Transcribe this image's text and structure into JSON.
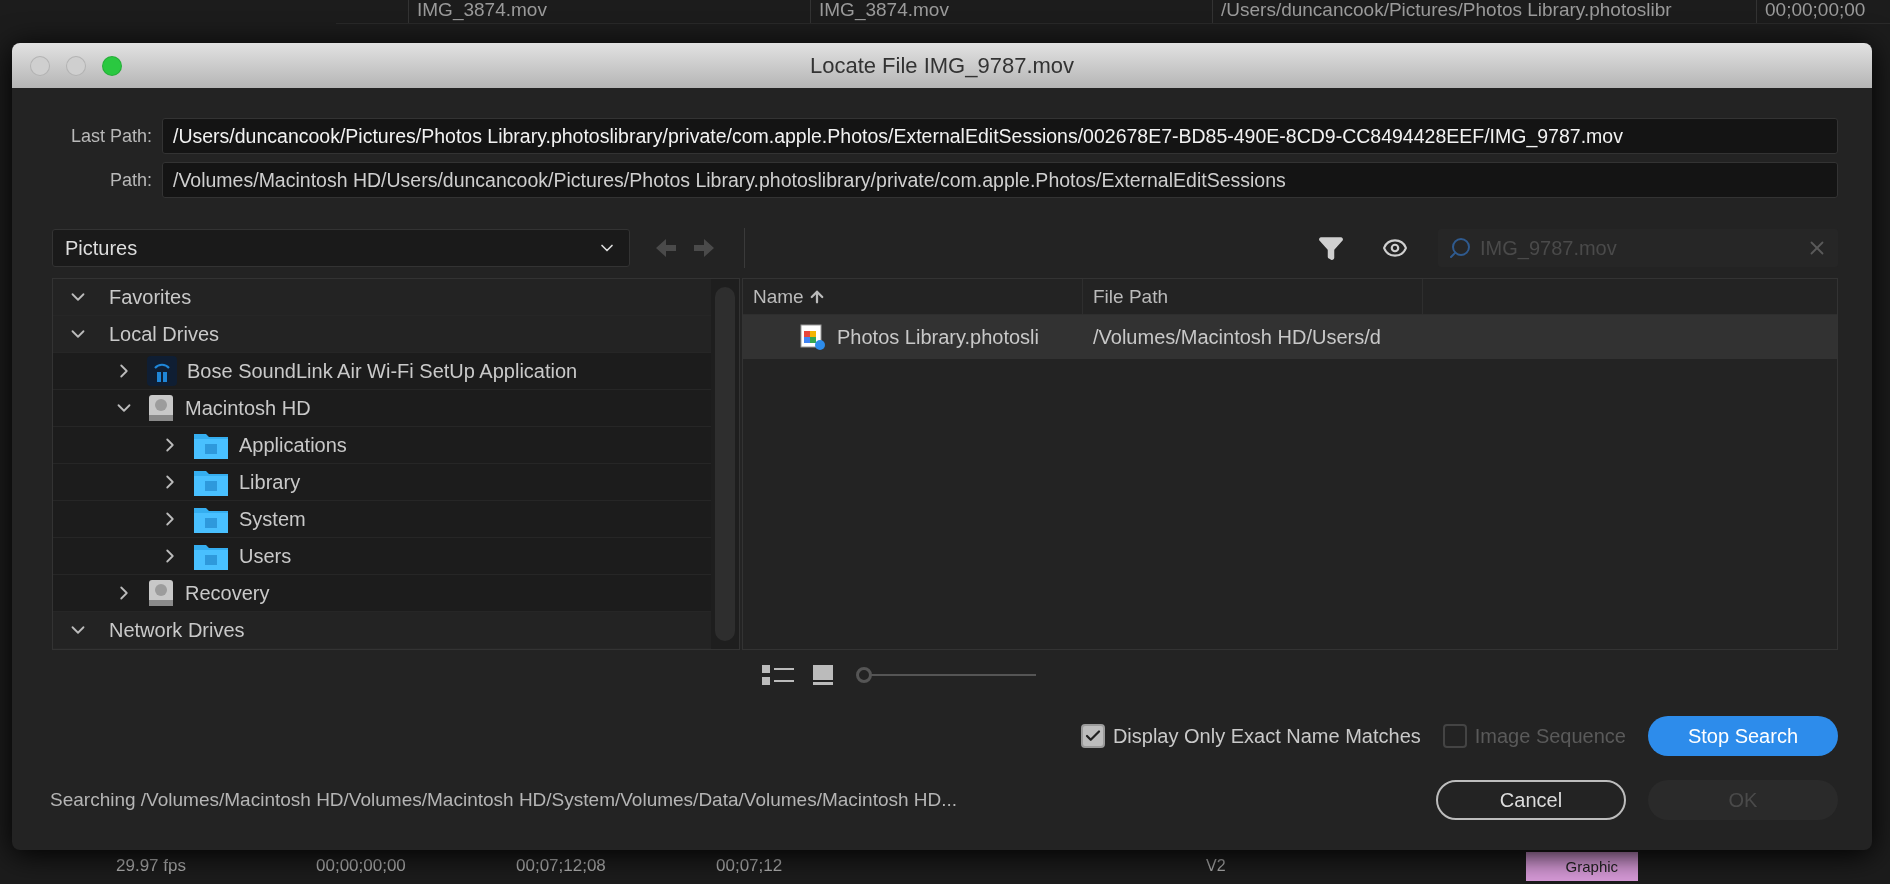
{
  "background": {
    "rows": [
      {
        "cells": [
          "IMG_3874.mov",
          "IMG_3874.mov",
          "/Users/duncancook/Pictures/Photos Library.photoslibr",
          "00;00;00;00"
        ]
      }
    ],
    "timeline": {
      "cells": [
        "29.97 fps",
        "00;00;00;00",
        "00;07;12;08",
        "00;07;12"
      ],
      "track": "V2",
      "clip": "Graphic"
    }
  },
  "dialog": {
    "title": "Locate File IMG_9787.mov",
    "last_path": {
      "label": "Last Path:",
      "value": "/Users/duncancook/Pictures/Photos Library.photoslibrary/private/com.apple.Photos/ExternalEditSessions/002678E7-BD85-490E-8CD9-CC8494428EEF/IMG_9787.mov"
    },
    "path": {
      "label": "Path:",
      "value": "/Volumes/Macintosh HD/Users/duncancook/Pictures/Photos Library.photoslibrary/private/com.apple.Photos/ExternalEditSessions"
    },
    "location": "Pictures",
    "search": {
      "value": "IMG_9787.mov",
      "disabled": true
    },
    "tree": [
      {
        "label": "Favorites",
        "kind": "section",
        "expanded": true
      },
      {
        "label": "Local Drives",
        "kind": "section",
        "expanded": true,
        "children": [
          {
            "label": "Bose SoundLink Air Wi-Fi SetUp Application",
            "kind": "app",
            "expanded": false
          },
          {
            "label": "Macintosh HD",
            "kind": "drive",
            "expanded": true,
            "children": [
              {
                "label": "Applications",
                "kind": "folder",
                "expanded": false
              },
              {
                "label": "Library",
                "kind": "folder",
                "expanded": false
              },
              {
                "label": "System",
                "kind": "folder",
                "expanded": false
              },
              {
                "label": "Users",
                "kind": "folder",
                "expanded": false
              }
            ]
          },
          {
            "label": "Recovery",
            "kind": "drive",
            "expanded": false
          }
        ]
      },
      {
        "label": "Network Drives",
        "kind": "section",
        "expanded": true
      }
    ],
    "columns": [
      {
        "label": "Name",
        "sorted": true
      },
      {
        "label": "File Path",
        "sorted": false
      }
    ],
    "rows": [
      {
        "cells": [
          "Photos Library.photosli",
          "/Volumes/Macintosh HD/Users/d"
        ],
        "selected": true
      }
    ],
    "thumbnail_size": {
      "level": 0
    },
    "options": [
      {
        "label": "Display Only Exact Name Matches",
        "checked": true,
        "disabled": false
      },
      {
        "label": "Image Sequence",
        "checked": false,
        "disabled": true
      }
    ],
    "stop_button": {
      "label": "Stop Search",
      "disabled": false
    },
    "status": "Searching /Volumes/Macintosh HD/Volumes/Macintosh HD/System/Volumes/Data/Volumes/Macintosh HD...",
    "buttons": [
      {
        "label": "Cancel",
        "kind": "outline",
        "disabled": false
      },
      {
        "label": "OK",
        "kind": "primary",
        "disabled": true
      }
    ]
  }
}
